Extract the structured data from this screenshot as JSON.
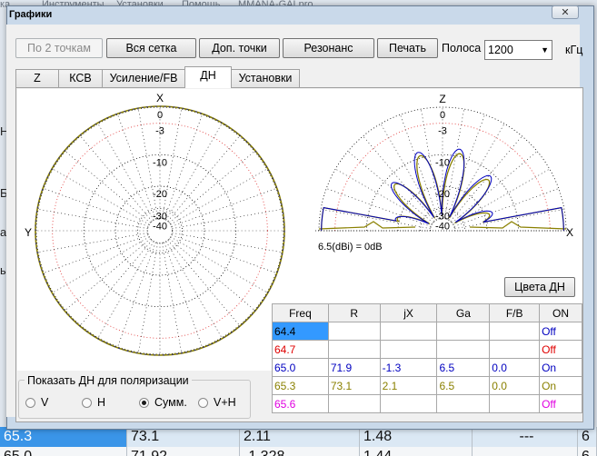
{
  "background": {
    "menu": [
      "ка",
      "Инструменты",
      "Установки",
      "Помощь",
      "MMANA-GALpro"
    ],
    "side_labels": [
      "На",
      "Б",
      "а",
      "ы"
    ],
    "row1": [
      "65.3",
      "73.1",
      "2.11",
      "1.48",
      "---",
      "6"
    ],
    "row2": [
      "65.0",
      "71.92",
      "-1.328",
      "1.44",
      "",
      "6."
    ]
  },
  "window": {
    "title": "Графики",
    "close_icon": "✕"
  },
  "toolbar": {
    "two_points": "По 2 точкам",
    "full_grid": "Вся сетка",
    "extra_points": "Доп. точки",
    "resonance": "Резонанс",
    "print": "Печать",
    "band_label": "Полоса",
    "band_value": "1200",
    "unit": "кГц"
  },
  "tabs": [
    "Z",
    "КСВ",
    "Усиление/FB",
    "ДН",
    "Установки"
  ],
  "pattern": {
    "horizontal": {
      "top_axis": "X",
      "left_axis": "Y",
      "rings": [
        "0",
        "-3",
        "-10",
        "-20",
        "-30",
        "-40"
      ]
    },
    "vertical": {
      "top_axis": "Z",
      "right_axis": "X",
      "rings": [
        "0",
        "-3",
        "-10",
        "-20",
        "-30",
        "-40"
      ]
    },
    "gain_ref": "6.5(dBi) = 0dB",
    "colors_button": "Цвета ДН"
  },
  "table": {
    "headers": [
      "Freq",
      "R",
      "jX",
      "Ga",
      "F/B",
      "ON"
    ],
    "rows": [
      {
        "color": "#0000c0",
        "cells": [
          "64.4",
          "",
          "",
          "",
          "",
          "Off"
        ],
        "selected": true
      },
      {
        "color": "#e00000",
        "cells": [
          "64.7",
          "",
          "",
          "",
          "",
          "Off"
        ]
      },
      {
        "color": "#0000c0",
        "cells": [
          "65.0",
          "71.9",
          "-1.3",
          "6.5",
          "0.0",
          "On"
        ]
      },
      {
        "color": "#8a8000",
        "cells": [
          "65.3",
          "73.1",
          "2.1",
          "6.5",
          "0.0",
          "On"
        ]
      },
      {
        "color": "#e000e0",
        "cells": [
          "65.6",
          "",
          "",
          "",
          "",
          "Off"
        ]
      }
    ]
  },
  "polarization": {
    "title": "Показать ДН для поляризации",
    "options": [
      "V",
      "H",
      "Сумм.",
      "V+H"
    ],
    "selected": 2
  }
}
